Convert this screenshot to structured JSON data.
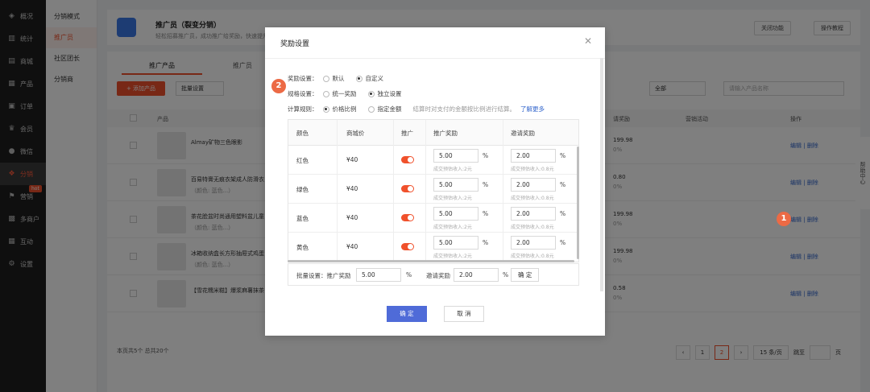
{
  "sidebar": {
    "items": [
      {
        "label": "概况",
        "icon": "layers-icon"
      },
      {
        "label": "统计",
        "icon": "bar-chart-icon"
      },
      {
        "label": "商城",
        "icon": "shop-icon"
      },
      {
        "label": "产品",
        "icon": "grid-icon"
      },
      {
        "label": "订单",
        "icon": "order-icon"
      },
      {
        "label": "会员",
        "icon": "crown-icon"
      },
      {
        "label": "微信",
        "icon": "chat-icon"
      },
      {
        "label": "分销",
        "icon": "share-icon"
      },
      {
        "label": "营销",
        "icon": "flag-icon"
      },
      {
        "label": "多商户",
        "icon": "store-icon"
      },
      {
        "label": "互动",
        "icon": "apps-icon"
      },
      {
        "label": "设置",
        "icon": "gear-icon"
      }
    ],
    "hot_badge": "hot"
  },
  "subnav": {
    "items": [
      "分销模式",
      "推广员",
      "社区团长",
      "分销商"
    ]
  },
  "header": {
    "title": "推广员（裂变分销）",
    "desc": "轻松招募推广员，成功推广给奖励，快速提升",
    "btn_close_feature": "关闭功能",
    "btn_tutorial": "操作教程"
  },
  "tabs": [
    "推广产品",
    "推广员"
  ],
  "toolbar": {
    "add_product": "+ 添加产品",
    "batch_settings": "批量设置",
    "filter_value": "全部",
    "search_placeholder": "请输入产品名称"
  },
  "table": {
    "headers": {
      "product": "产品",
      "reward": "请奖励",
      "marketing": "营销活动",
      "ops": "操作"
    },
    "rows": [
      {
        "name": "Almay矿物三色眼影",
        "meta": "",
        "reward": "199.98",
        "reward2": "0%"
      },
      {
        "name": "百易特膏无痕衣架成人防滑衣",
        "meta": "（颜色: 蓝色...）",
        "reward": "0.80",
        "reward2": "0%"
      },
      {
        "name": "茶花脸盆时尚通用塑料盆儿童",
        "meta": "（颜色: 蓝色...）",
        "reward": "199.98",
        "reward2": "0%"
      },
      {
        "name": "冰箱收纳盒长方形抽屉式鸡蛋",
        "meta": "（颜色: 蓝色...）",
        "reward": "199.98",
        "reward2": "0%"
      },
      {
        "name": "【雪花糯米糍】爆浆麻薯抹茶",
        "meta": "",
        "reward": "0.58",
        "reward2": "0%"
      }
    ],
    "op_edit": "编辑",
    "op_delete": "删除"
  },
  "footer": {
    "summary": "本页共5个 总共20个",
    "pages": [
      "1",
      "2"
    ],
    "page_size": "15 条/页",
    "goto_label": "跳至",
    "page_unit": "页"
  },
  "help": {
    "label": "帮助中心"
  },
  "modal": {
    "title": "奖励设置",
    "reward_setting_label": "奖励设置：",
    "reward_options": [
      "默认",
      "自定义"
    ],
    "spec_setting_label": "规格设置：",
    "spec_options": [
      "统一奖励",
      "独立设置"
    ],
    "calc_rule_label": "计算规则：",
    "calc_options": [
      "价格比例",
      "指定金额"
    ],
    "calc_hint": "结算时对支付的金额按比例进行结算。",
    "learn_more": "了解更多",
    "columns": {
      "color": "颜色",
      "price": "商城价",
      "promote": "推广",
      "promo_reward": "推广奖励",
      "invite_reward": "邀请奖励"
    },
    "pct": "%",
    "rows": [
      {
        "color": "红色",
        "price": "¥40",
        "promo": "5.00",
        "promo_hint": "成交预估收入:2元",
        "invite": "2.00",
        "invite_hint": "成交预估收入:0.8元"
      },
      {
        "color": "绿色",
        "price": "¥40",
        "promo": "5.00",
        "promo_hint": "成交预估收入:2元",
        "invite": "2.00",
        "invite_hint": "成交预估收入:0.8元"
      },
      {
        "color": "蓝色",
        "price": "¥40",
        "promo": "5.00",
        "promo_hint": "成交预估收入:2元",
        "invite": "2.00",
        "invite_hint": "成交预估收入:0.8元"
      },
      {
        "color": "黄色",
        "price": "¥40",
        "promo": "5.00",
        "promo_hint": "成交预估收入:2元",
        "invite": "2.00",
        "invite_hint": "成交预估收入:0.8元"
      }
    ],
    "batch": {
      "label": "批量设置：推广奖励",
      "promo_value": "5.00",
      "invite_label": "邀请奖励",
      "invite_value": "2.00",
      "confirm": "确 定"
    },
    "ok": "确 定",
    "cancel": "取 消"
  },
  "annotations": {
    "one": "1",
    "two": "2"
  },
  "colors": {
    "accent": "#f0512c",
    "primary": "#4f6bd8",
    "link": "#3366cc"
  }
}
